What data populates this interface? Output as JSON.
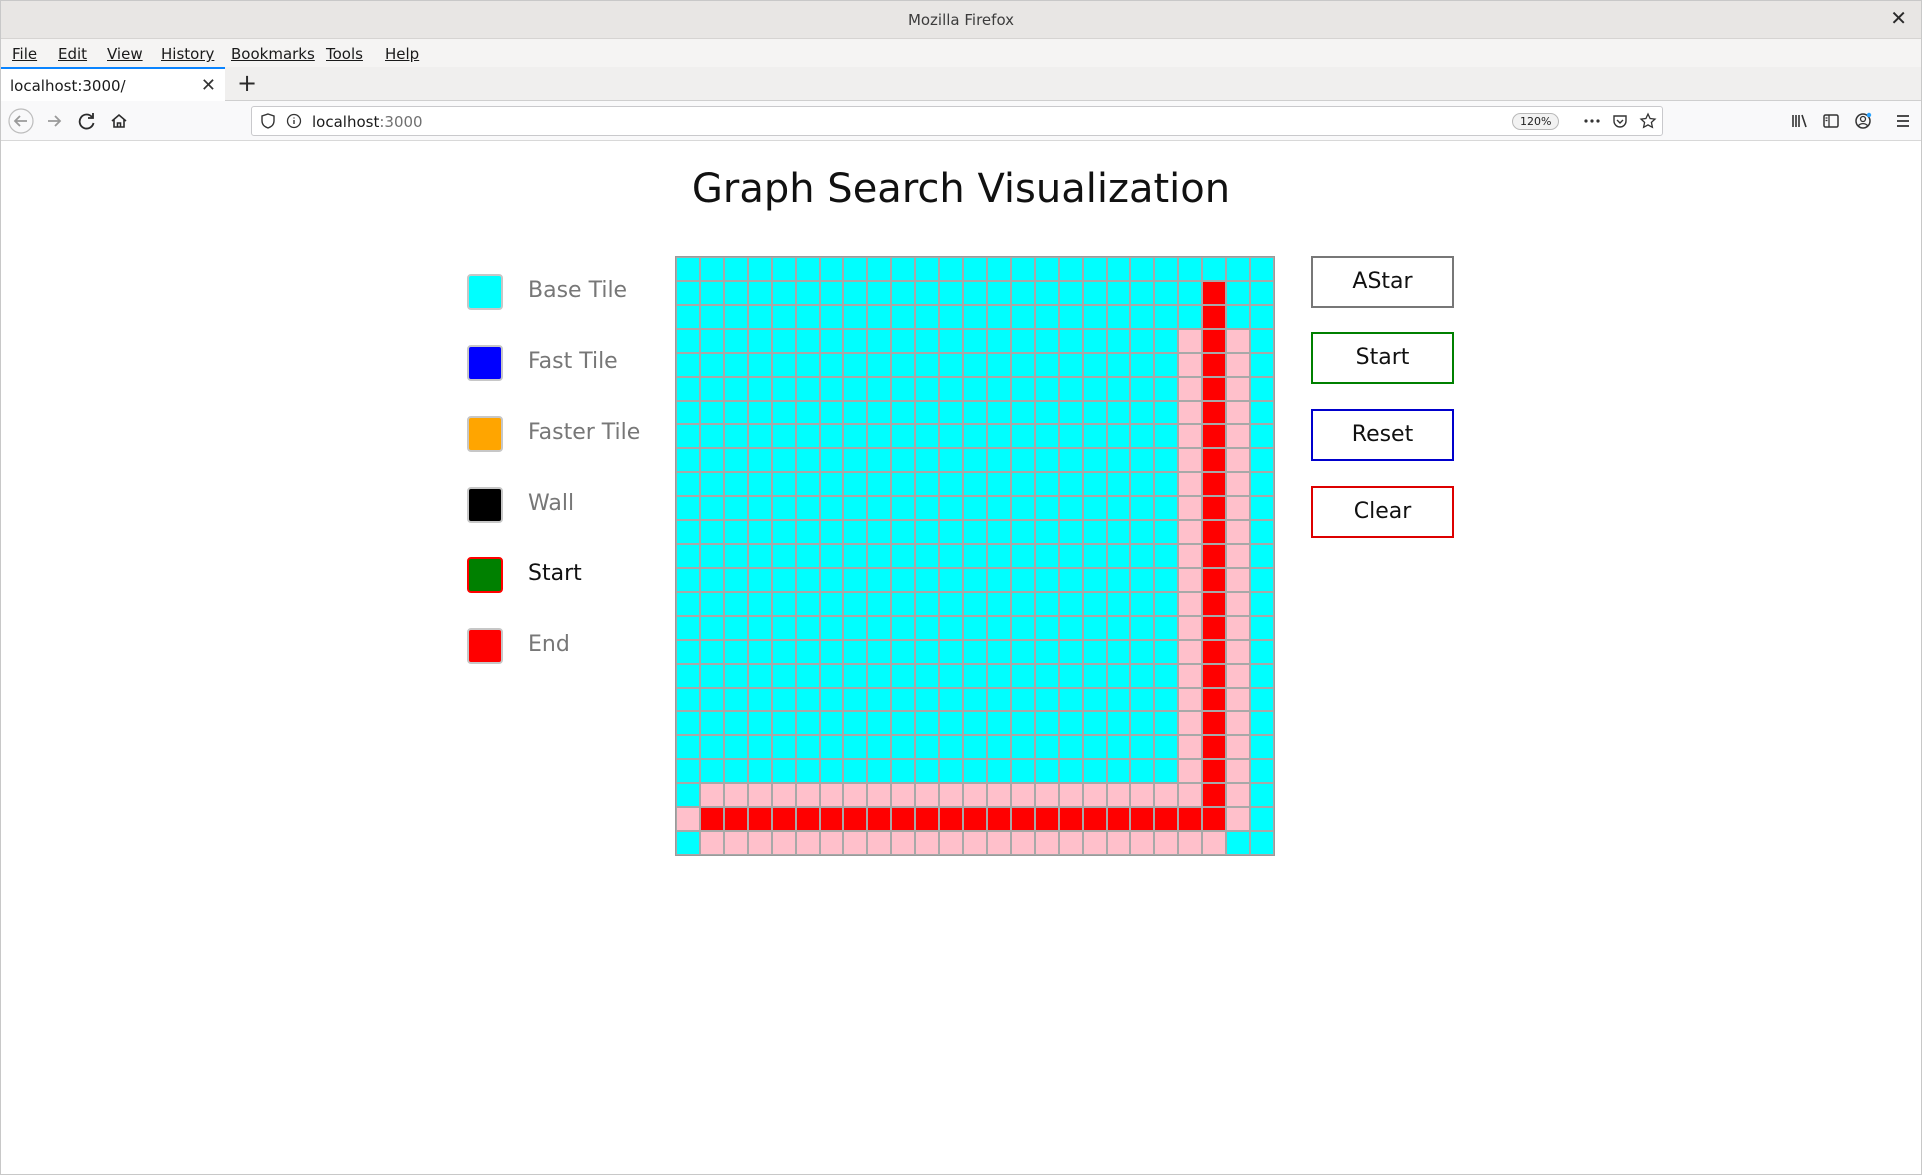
{
  "window": {
    "title": "Mozilla Firefox",
    "close_glyph": "✕"
  },
  "menu": [
    {
      "accel": "F",
      "rest": "ile"
    },
    {
      "accel": "E",
      "rest": "dit"
    },
    {
      "accel": "V",
      "rest": "iew"
    },
    {
      "accel": "",
      "pre": "Hi",
      "accel2": "s",
      "rest": "tory"
    },
    {
      "accel": "B",
      "rest": "ookmarks"
    },
    {
      "accel": "T",
      "rest": "ools"
    },
    {
      "accel": "H",
      "rest": "elp"
    }
  ],
  "menu_labels": [
    "File",
    "Edit",
    "View",
    "History",
    "Bookmarks",
    "Tools",
    "Help"
  ],
  "tabs": [
    {
      "label": "localhost:3000/",
      "close_glyph": "✕"
    }
  ],
  "newtab_glyph": "+",
  "urlbar": {
    "host": "localhost",
    "port": ":3000",
    "zoom": "120%"
  },
  "icons": {
    "back": "back-arrow-icon",
    "forward": "forward-arrow-icon",
    "reload": "reload-icon",
    "home": "home-icon",
    "shield": "tracking-shield-icon",
    "info": "site-info-icon",
    "more": "more-actions-icon",
    "pocket": "pocket-icon",
    "star": "bookmark-star-icon",
    "library": "library-icon",
    "sidebar": "sidebar-icon",
    "account": "account-icon",
    "menu": "hamburger-menu-icon"
  },
  "page": {
    "title": "Graph Search Visualization"
  },
  "legend": [
    {
      "label": "Base Tile",
      "color": "#00ffff",
      "active": false
    },
    {
      "label": "Fast Tile",
      "color": "#0000ff",
      "active": false
    },
    {
      "label": "Faster Tile",
      "color": "#ffa500",
      "active": false
    },
    {
      "label": "Wall",
      "color": "#000000",
      "active": false
    },
    {
      "label": "Start",
      "color": "#008000",
      "active": true
    },
    {
      "label": "End",
      "color": "#ff0000",
      "active": false
    }
  ],
  "grid": {
    "size": 25,
    "colors": {
      "base": "#00ffff",
      "visited": "#ffc0cb",
      "path": "#ff0000"
    },
    "path_column": 22,
    "path_col_rows": [
      1,
      22
    ],
    "path_row": 23,
    "path_row_cols": [
      1,
      22
    ],
    "visited_side_columns": [
      21,
      23
    ],
    "visited_side_rows": [
      3,
      22
    ],
    "visited_rows": [
      22,
      24
    ],
    "visited_row_cols": [
      1,
      22
    ],
    "visited_extra": [
      [
        23,
        0
      ],
      [
        23,
        23
      ],
      [
        1,
        22
      ]
    ]
  },
  "buttons": [
    {
      "label": "AStar",
      "border": "#777777"
    },
    {
      "label": "Start",
      "border": "#008000"
    },
    {
      "label": "Reset",
      "border": "#0000cc"
    },
    {
      "label": "Clear",
      "border": "#dd0000"
    }
  ]
}
